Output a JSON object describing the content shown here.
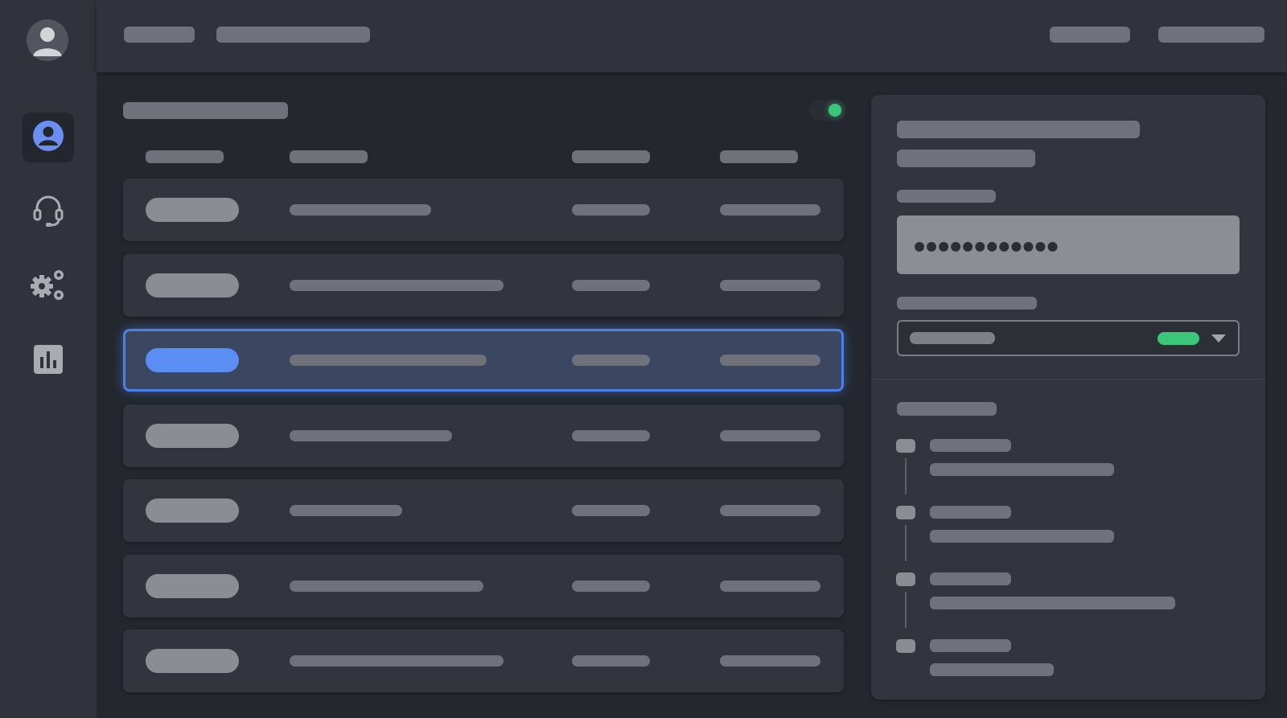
{
  "app": {
    "theme": "dark",
    "accent_color": "#4c7fe8",
    "success_color": "#3cc67a"
  },
  "sidebar": {
    "avatar_icon": "user-avatar-icon",
    "items": [
      {
        "icon": "user-circle-icon",
        "active": true
      },
      {
        "icon": "headset-icon",
        "active": false
      },
      {
        "icon": "gears-icon",
        "active": false
      },
      {
        "icon": "bar-chart-icon",
        "active": false
      }
    ]
  },
  "main": {
    "status": {
      "state": "online",
      "color": "#3cc67a"
    },
    "selected_row_index": 2,
    "row_count": 7
  },
  "details": {
    "password_mask": "●●●●●●●●●●●●",
    "select_badge_color": "#3cc67a",
    "timeline_entries": 4
  }
}
